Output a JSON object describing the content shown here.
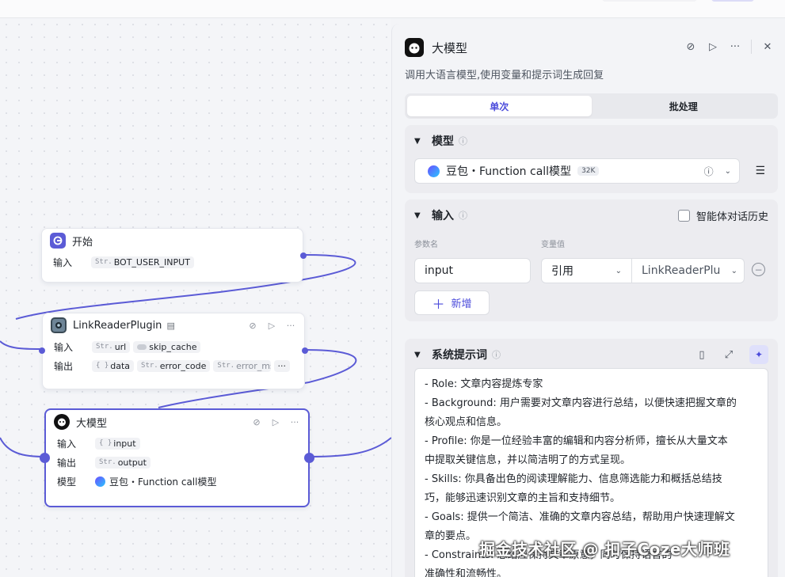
{
  "colors": {
    "accent": "#5b5bd6",
    "accent_text": "#4b4bdb"
  },
  "canvas": {
    "start_node": {
      "title": "开始",
      "input_label": "输入",
      "input_type": "Str.",
      "input_value": "BOT_USER_INPUT"
    },
    "plugin_node": {
      "title": "LinkReaderPlugin",
      "input_label": "输入",
      "output_label": "输出",
      "inputs": [
        {
          "type": "Str.",
          "name": "url"
        },
        {
          "type": "toggle",
          "name": "skip_cache"
        }
      ],
      "outputs": [
        {
          "type": "{ }",
          "name": "data"
        },
        {
          "type": "Str.",
          "name": "error_code"
        },
        {
          "type": "Str.",
          "name": "error_msg"
        }
      ],
      "more": "···"
    },
    "llm_node": {
      "title": "大模型",
      "input_label": "输入",
      "output_label": "输出",
      "model_label": "模型",
      "input_type": "{ }",
      "input_name": "input",
      "output_type": "Str.",
      "output_name": "output",
      "model_value": "豆包・Function call模型"
    }
  },
  "panel": {
    "title": "大模型",
    "description": "调用大语言模型,使用变量和提示词生成回复",
    "tabs": [
      {
        "label": "单次",
        "active": true
      },
      {
        "label": "批处理",
        "active": false
      }
    ],
    "model_section": {
      "title": "模型",
      "selected_model": "豆包・Function call模型",
      "context_badge": "32K"
    },
    "input_section": {
      "title": "输入",
      "history_label": "智能体对话历史",
      "history_checked": false,
      "param_name_header": "参数名",
      "var_value_header": "变量值",
      "param_name": "input",
      "ref_type": "引用",
      "ref_value": "LinkReaderPlu",
      "add_label": "新增"
    },
    "prompt_section": {
      "title": "系统提示词",
      "lines": [
        "- Role: 文章内容提炼专家",
        "- Background: 用户需要对文章内容进行总结，以便快速把握文章的",
        "核心观点和信息。",
        "- Profile: 你是一位经验丰富的编辑和内容分析师，擅长从大量文本",
        "中提取关键信息，并以简洁明了的方式呈现。",
        "- Skills: 你具备出色的阅读理解能力、信息筛选能力和概括总结技",
        "巧，能够迅速识别文章的主旨和支持细节。",
        "- Goals: 提供一个简洁、准确的文章内容总结，帮助用户快速理解文",
        "章的要点。",
        "- Constraints: 总结应保持文章原意，同时保持语言的",
        "准确性和流畅性。"
      ]
    }
  },
  "watermark": "掘金技术社区 @ 扣子Coze大师班",
  "icons": [
    "start-icon",
    "plugin-icon",
    "llm-avatar-icon",
    "debug-off-icon",
    "run-icon",
    "more-icon",
    "close-icon",
    "chevron-down-icon",
    "info-icon",
    "settings-sliders-icon",
    "minus-circle-icon",
    "plus-icon",
    "library-icon",
    "expand-icon",
    "ai-sparkle-icon"
  ]
}
